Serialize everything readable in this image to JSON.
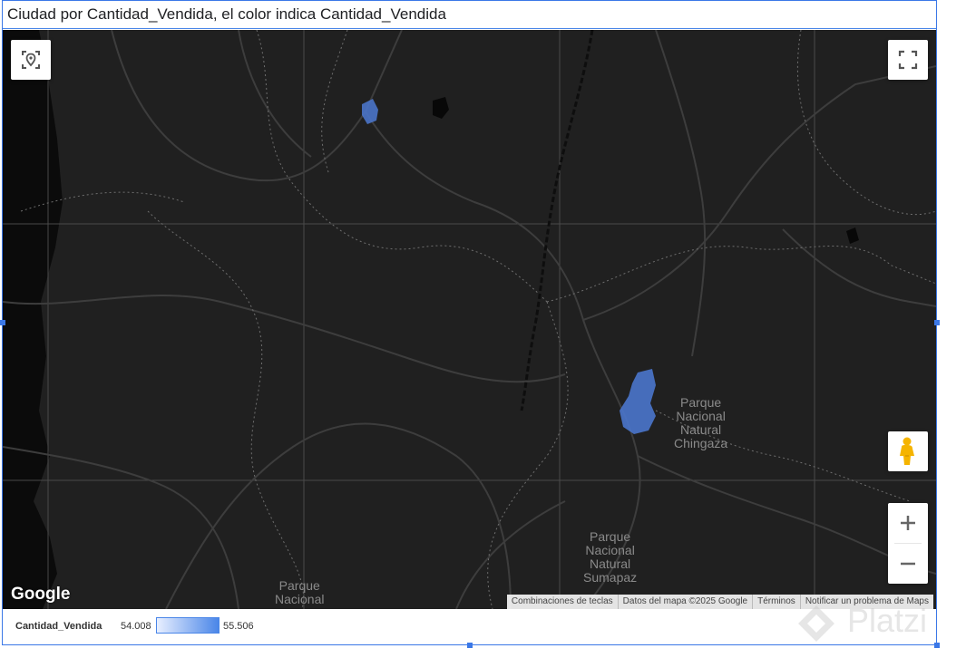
{
  "chart": {
    "title": "Ciudad por Cantidad_Vendida, el color indica Cantidad_Vendida"
  },
  "map": {
    "place_labels": [
      {
        "name": "parque-chingaza",
        "text": "Parque\nNacional\nNatural\nChingaza"
      },
      {
        "name": "parque-sumapaz",
        "text": "Parque\nNacional\nNatural\nSumapaz"
      },
      {
        "name": "parque-partial",
        "text": "Parque\nNacional"
      }
    ],
    "controls": {
      "zoom_in": "+",
      "zoom_out": "−"
    },
    "google_logo": "Google",
    "attribution": {
      "shortcuts": "Combinaciones de teclas",
      "map_data": "Datos del mapa ©2025 Google",
      "terms": "Términos",
      "report": "Notificar un problema de Maps"
    },
    "icons": [
      "my-location-icon",
      "fullscreen-icon",
      "pegman-icon",
      "zoom-in-icon",
      "zoom-out-icon"
    ],
    "regions_color": "#4a74c9"
  },
  "legend": {
    "title": "Cantidad_Vendida",
    "min": "54.008",
    "max": "55.506",
    "color_low": "#e8efff",
    "color_high": "#4a86e8"
  },
  "watermark": "Platzi"
}
